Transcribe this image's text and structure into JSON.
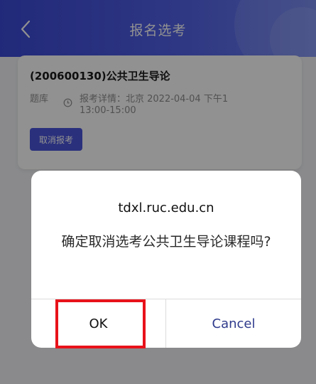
{
  "header": {
    "title": "报名选考",
    "back_icon": "chevron-left-icon"
  },
  "exam_card": {
    "title": "(200600130)公共卫生导论",
    "label": "题库",
    "clock_icon": "clock-icon",
    "detail_line1": "报考详情：北京 2022-04-04 下午1",
    "detail_line2": "13:00-15:00",
    "cancel_signup_label": "取消报考"
  },
  "dialog": {
    "host": "tdxl.ruc.edu.cn",
    "message": "确定取消选考公共卫生导论课程吗?",
    "ok_label": "OK",
    "cancel_label": "Cancel"
  },
  "colors": {
    "header_start": "#3b49d6",
    "header_end": "#6b80f0",
    "button_accent": "#4b55da",
    "cancel_text": "#2e3a8c",
    "highlight": "#e8121a"
  }
}
